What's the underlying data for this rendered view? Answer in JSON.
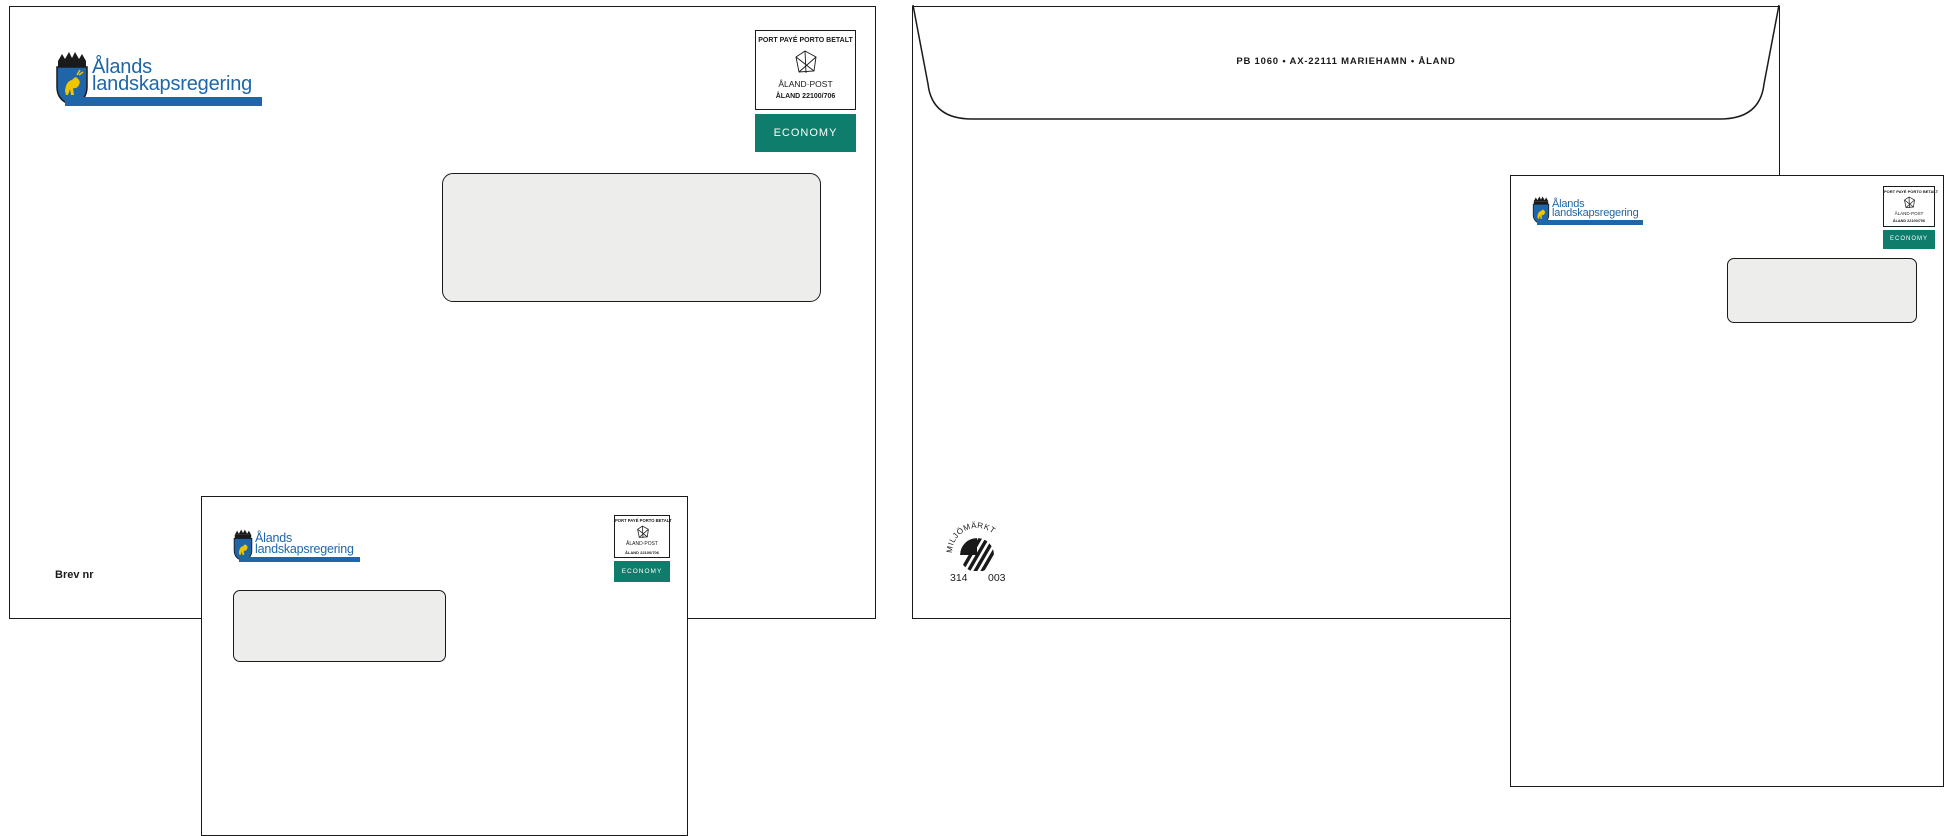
{
  "envelopes": {
    "large_window": {
      "logo": {
        "line1": "Ålands",
        "line2": "landskapsregering"
      },
      "stamp": {
        "line1": "PORT PAYÉ PORTO BETALT",
        "line2": "ÅLAND·POST",
        "line3": "ÅLAND 22100/706"
      },
      "economy": "ECONOMY",
      "brev_label": "Brev nr"
    },
    "back": {
      "return_address": "PB 1060 • AX-22111 MARIEHAMN • ÅLAND",
      "ecolabel": {
        "arc_text": "MILJÖMÄRKT",
        "number_left": "314",
        "number_right": "003"
      }
    },
    "small_window": {
      "logo": {
        "line1": "Ålands",
        "line2": "landskapsregering"
      },
      "stamp": {
        "line1": "PORT PAYÉ PORTO BETALT",
        "line2": "ÅLAND·POST",
        "line3": "ÅLAND 22100/706"
      },
      "economy": "ECONOMY"
    },
    "portrait": {
      "logo": {
        "line1": "Ålands",
        "line2": "landskapsregering"
      },
      "stamp": {
        "line1": "PORT PAYÉ PORTO BETALT",
        "line2": "ÅLAND·POST",
        "line3": "ÅLAND 22100/706"
      },
      "economy": "ECONOMY"
    }
  },
  "colors": {
    "brand_blue": "#1e66a8",
    "economy_green": "#0e7d6b",
    "window_gray": "#ededec",
    "crest_gold": "#f1c400"
  }
}
